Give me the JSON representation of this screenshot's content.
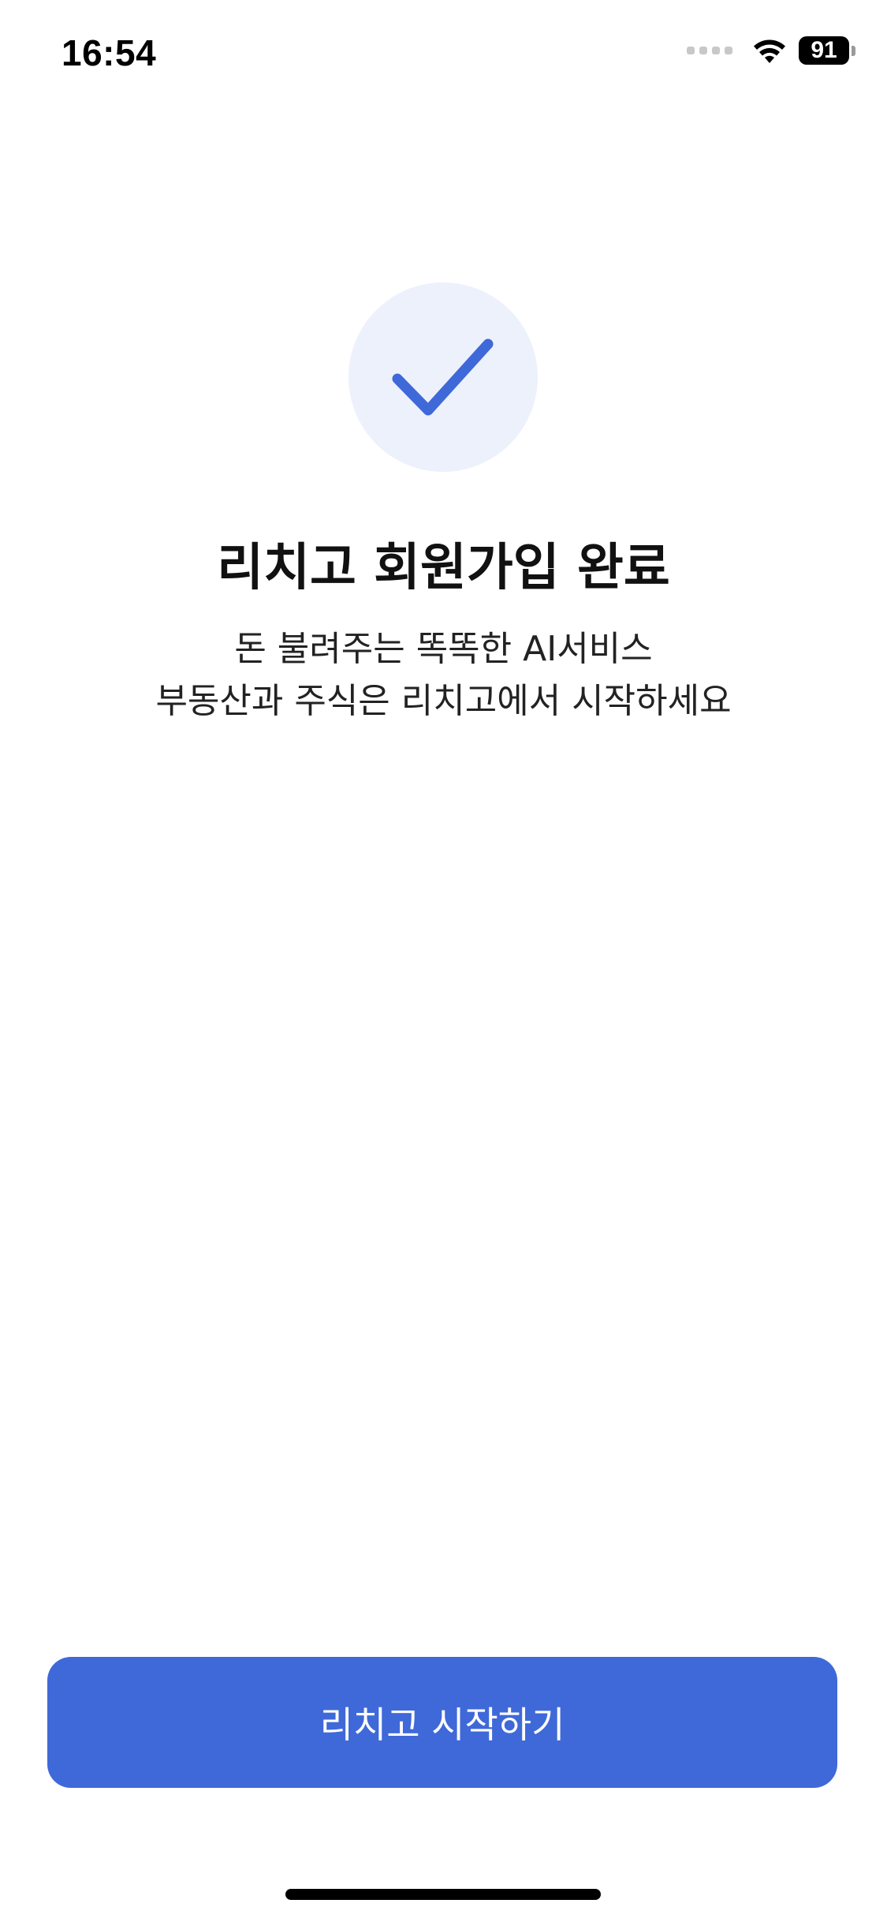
{
  "status_bar": {
    "time": "16:54",
    "battery_level": "91",
    "wifi_icon": "wifi-icon",
    "signal_icon": "cellular-signal-icon"
  },
  "main": {
    "icon": "checkmark-icon",
    "title": "리치고 회원가입 완료",
    "subtitle_lines": [
      "돈 불려주는 똑똑한 AI서비스",
      "부동산과 주식은 리치고에서 시작하세요"
    ]
  },
  "footer": {
    "start_button_label": "리치고 시작하기"
  },
  "colors": {
    "accent": "#3f69d9",
    "check_circle_bg": "#edf1fc",
    "check_stroke": "#3f69d9"
  }
}
